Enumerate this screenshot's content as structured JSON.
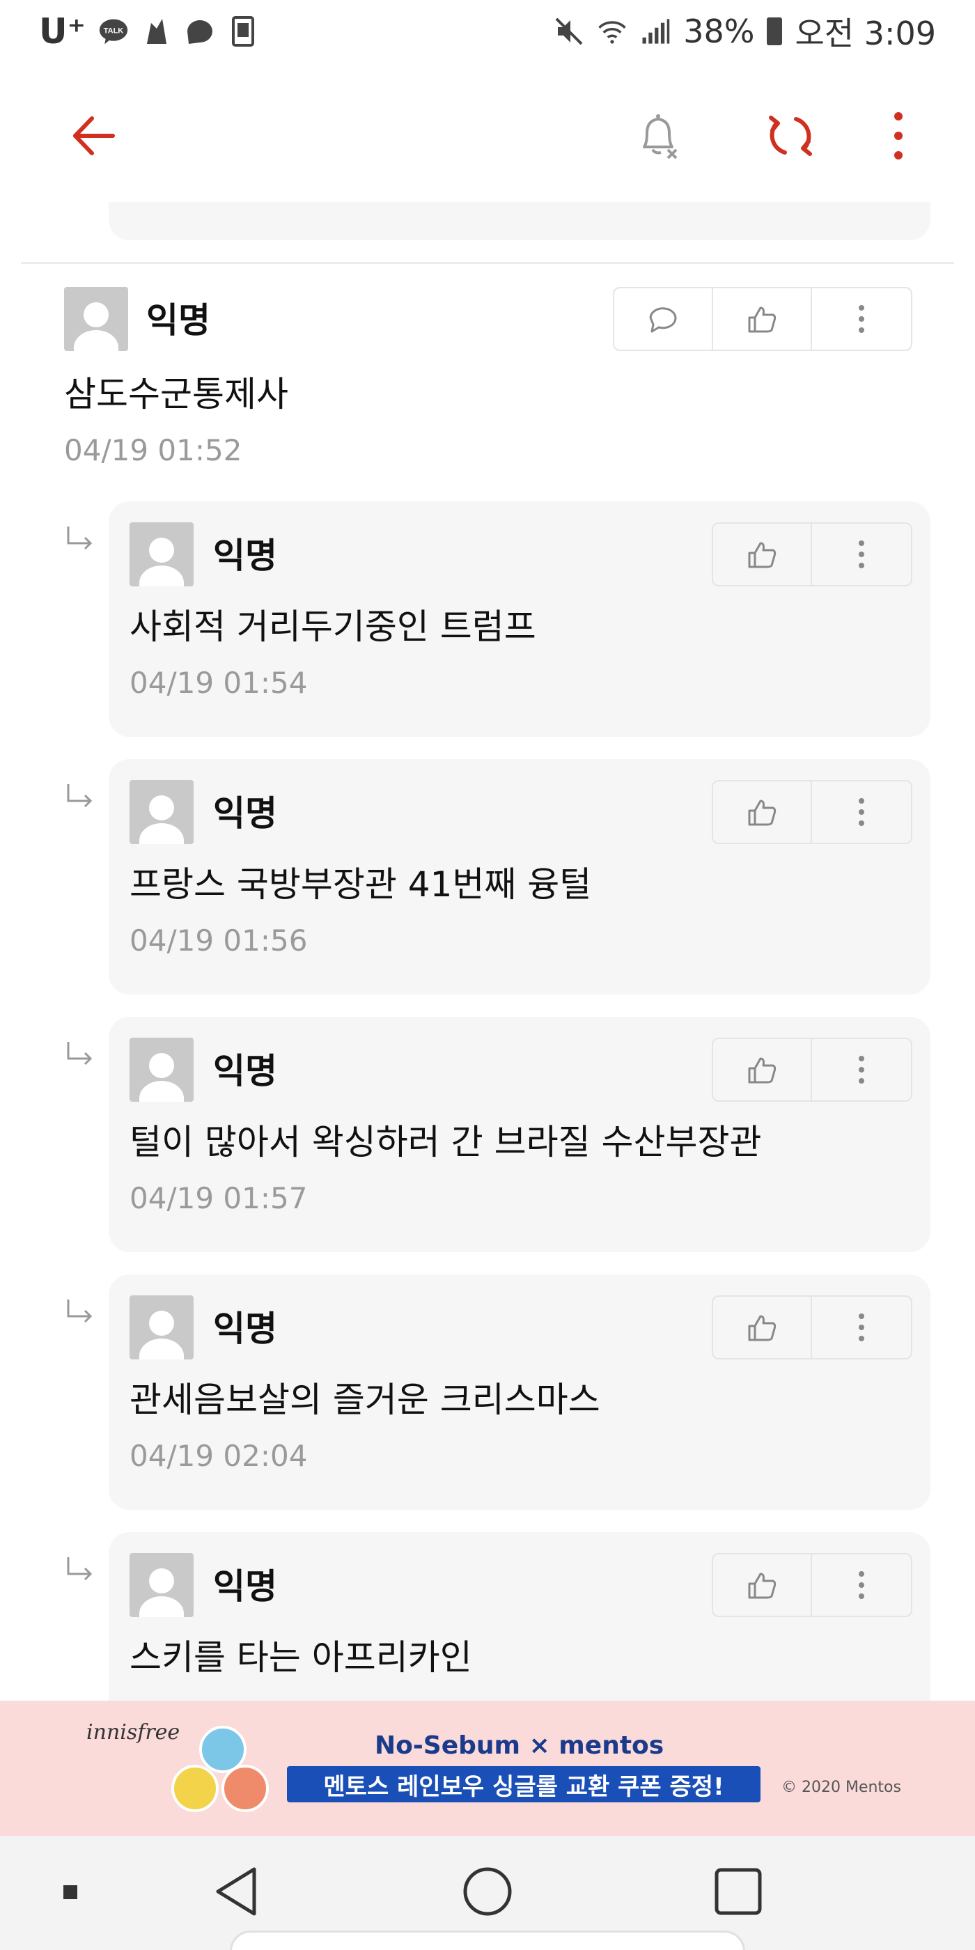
{
  "status_bar": {
    "carrier": "U⁺",
    "talk_badge": "TALK",
    "left_icons": [
      "kakaotalk-icon",
      "app-icon",
      "chat-bubble-icon",
      "screenshot-icon"
    ],
    "right_icons": [
      "mute-icon",
      "wifi-icon",
      "signal-icon"
    ],
    "battery": "38%",
    "time": "오전 3:09"
  },
  "app_bar": {
    "icons": [
      "back-arrow-icon",
      "bell-off-icon",
      "refresh-icon",
      "more-vertical-icon"
    ],
    "accent": "#d0301f"
  },
  "comments": [
    {
      "author": "익명",
      "text": "삼도수군통제사",
      "time": "04/19 01:52"
    }
  ],
  "replies": [
    {
      "author": "익명",
      "text": "사회적 거리두기중인 트럼프",
      "time": "04/19 01:54"
    },
    {
      "author": "익명",
      "text": "프랑스 국방부장관 41번째 융털",
      "time": "04/19 01:56"
    },
    {
      "author": "익명",
      "text": "털이 많아서 왁싱하러 간 브라질 수산부장관",
      "time": "04/19 01:57"
    },
    {
      "author": "익명",
      "text": "관세음보살의 즐거운 크리스마스",
      "time": "04/19 02:04"
    },
    {
      "author": "익명",
      "text": "스키를 타는 아프리카인",
      "time": ""
    }
  ],
  "ad": {
    "brand": "innisfree",
    "title": "No-Sebum × mentos",
    "promo": "멘토스 레인보우 싱글롤 교환 쿠폰 증정!",
    "copyright": "© 2020 Mentos"
  },
  "nav_bar": {
    "icons": [
      "recents-square-small-icon",
      "back-triangle-icon",
      "home-circle-icon",
      "overview-square-icon"
    ]
  }
}
